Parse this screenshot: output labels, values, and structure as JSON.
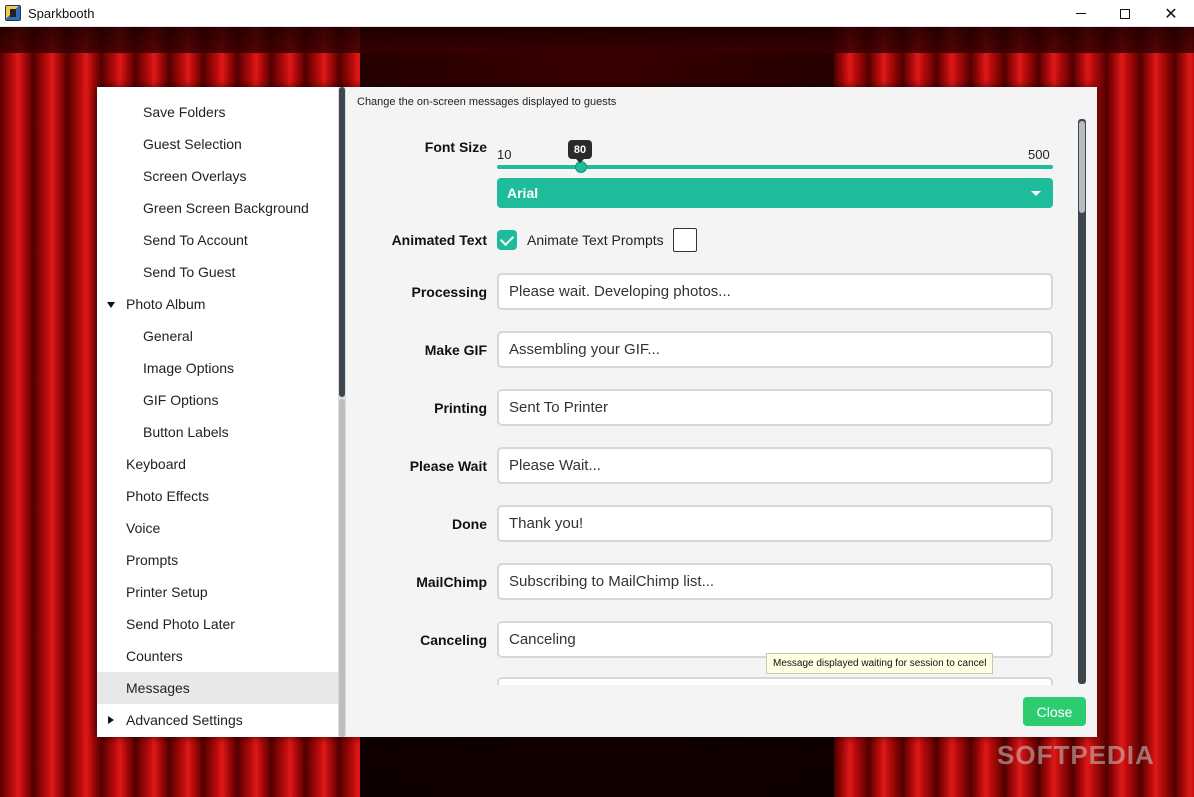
{
  "window": {
    "title": "Sparkbooth",
    "minimize_label": "—",
    "maximize_label": "☐",
    "close_label": "✕"
  },
  "sidebar": {
    "items": [
      {
        "label": "Save Folders",
        "level": 2
      },
      {
        "label": "Guest Selection",
        "level": 2
      },
      {
        "label": "Screen Overlays",
        "level": 2
      },
      {
        "label": "Green Screen Background",
        "level": 2
      },
      {
        "label": "Send To Account",
        "level": 2
      },
      {
        "label": "Send To Guest",
        "level": 2
      },
      {
        "label": "Photo Album",
        "level": 1,
        "expanded": true
      },
      {
        "label": "General",
        "level": 2
      },
      {
        "label": "Image Options",
        "level": 2
      },
      {
        "label": "GIF Options",
        "level": 2
      },
      {
        "label": "Button Labels",
        "level": 2
      },
      {
        "label": "Keyboard",
        "level": 1
      },
      {
        "label": "Photo Effects",
        "level": 1
      },
      {
        "label": "Voice",
        "level": 1
      },
      {
        "label": "Prompts",
        "level": 1
      },
      {
        "label": "Printer Setup",
        "level": 1
      },
      {
        "label": "Send Photo Later",
        "level": 1
      },
      {
        "label": "Counters",
        "level": 1
      },
      {
        "label": "Messages",
        "level": 1,
        "active": true
      },
      {
        "label": "Advanced Settings",
        "level": 1,
        "expanded": false
      }
    ]
  },
  "main": {
    "subtitle": "Change the on-screen messages displayed to guests",
    "font_size": {
      "label": "Font Size",
      "min": "10",
      "max": "500",
      "value": "80"
    },
    "font_family": {
      "selected": "Arial"
    },
    "animated_text": {
      "label": "Animated Text",
      "checked": true,
      "prompts_label": "Animate Text Prompts",
      "prompts_checked": false
    },
    "messages": [
      {
        "label": "Processing",
        "value": "Please wait. Developing photos..."
      },
      {
        "label": "Make GIF",
        "value": "Assembling your GIF..."
      },
      {
        "label": "Printing",
        "value": "Sent To Printer"
      },
      {
        "label": "Please Wait",
        "value": "Please Wait..."
      },
      {
        "label": "Done",
        "value": "Thank you!"
      },
      {
        "label": "MailChimp",
        "value": "Subscribing to MailChimp list..."
      },
      {
        "label": "Canceling",
        "value": "Canceling"
      }
    ],
    "tooltip": "Message displayed waiting for session to cancel",
    "close_label": "Close"
  },
  "watermark": "SOFTPEDIA",
  "colors": {
    "accent": "#1fbc9c",
    "close_button": "#2ecc71",
    "curtain": "#c40d0d"
  }
}
